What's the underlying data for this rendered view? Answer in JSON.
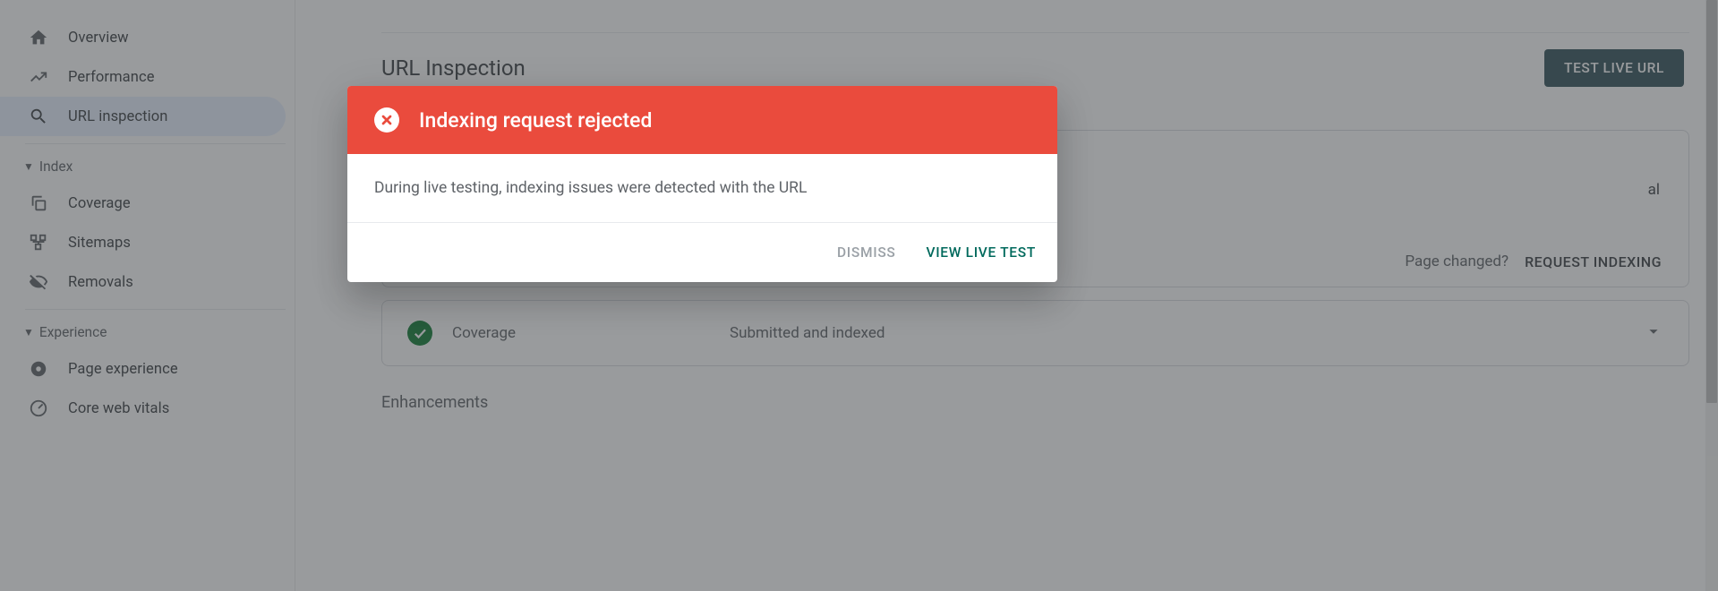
{
  "sidebar": {
    "items": [
      {
        "label": "Overview"
      },
      {
        "label": "Performance"
      },
      {
        "label": "URL inspection"
      }
    ],
    "sections": [
      {
        "header": "Index",
        "items": [
          {
            "label": "Coverage"
          },
          {
            "label": "Sitemaps"
          },
          {
            "label": "Removals"
          }
        ]
      },
      {
        "header": "Experience",
        "items": [
          {
            "label": "Page experience"
          },
          {
            "label": "Core web vitals"
          }
        ]
      }
    ]
  },
  "main": {
    "title": "URL Inspection",
    "test_button": "TEST LIVE URL",
    "top_card_tail": "al",
    "page_changed": "Page changed?",
    "request_indexing": "REQUEST INDEXING",
    "coverage": {
      "label": "Coverage",
      "status": "Submitted and indexed"
    },
    "enhancements": "Enhancements"
  },
  "modal": {
    "title": "Indexing request rejected",
    "body": "During live testing, indexing issues were detected with the URL",
    "dismiss": "DISMISS",
    "view": "VIEW LIVE TEST"
  }
}
